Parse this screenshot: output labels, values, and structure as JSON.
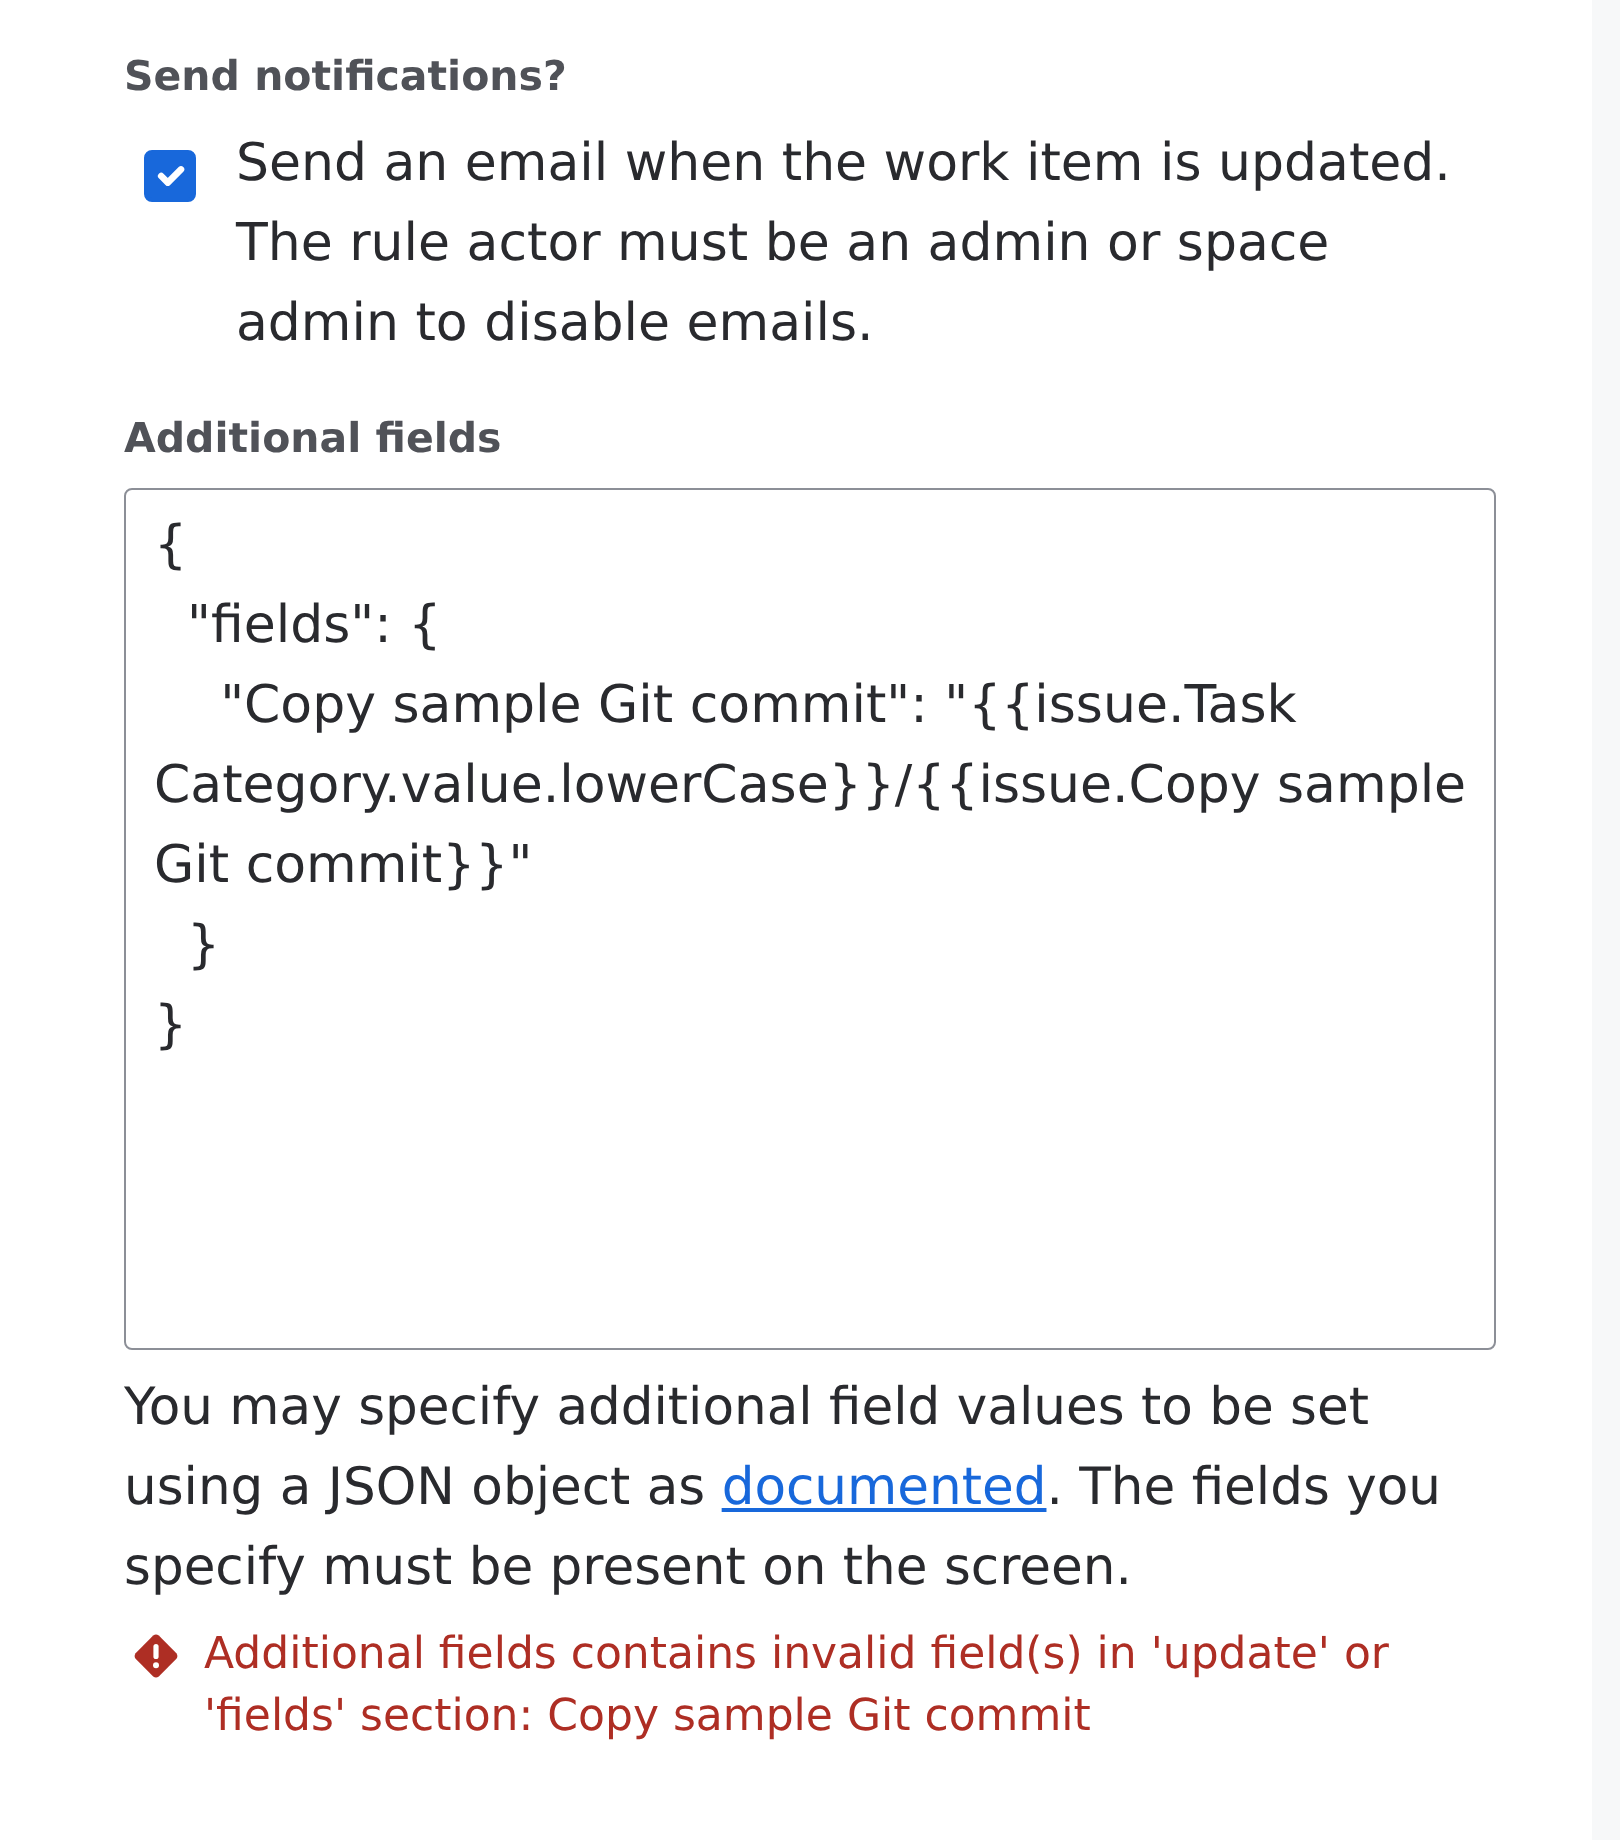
{
  "notifications": {
    "label": "Send notifications?",
    "checkbox": {
      "checked": true,
      "label": "Send an email when the work item is updated. The rule actor must be an admin or space admin to disable emails."
    }
  },
  "additional_fields": {
    "label": "Additional fields",
    "value": "{\n  \"fields\": {\n    \"Copy sample Git commit\": \"{{issue.Task Category.value.lowerCase}}/{{issue.Copy sample Git commit}}\"\n  }\n}",
    "help": {
      "text_before": "You may specify additional field values to be set using a JSON object as ",
      "link": "documented",
      "text_after": ". The fields you specify must be present on the screen."
    },
    "error": "Additional fields contains invalid field(s) in 'update' or 'fields' section: Copy sample Git commit"
  }
}
